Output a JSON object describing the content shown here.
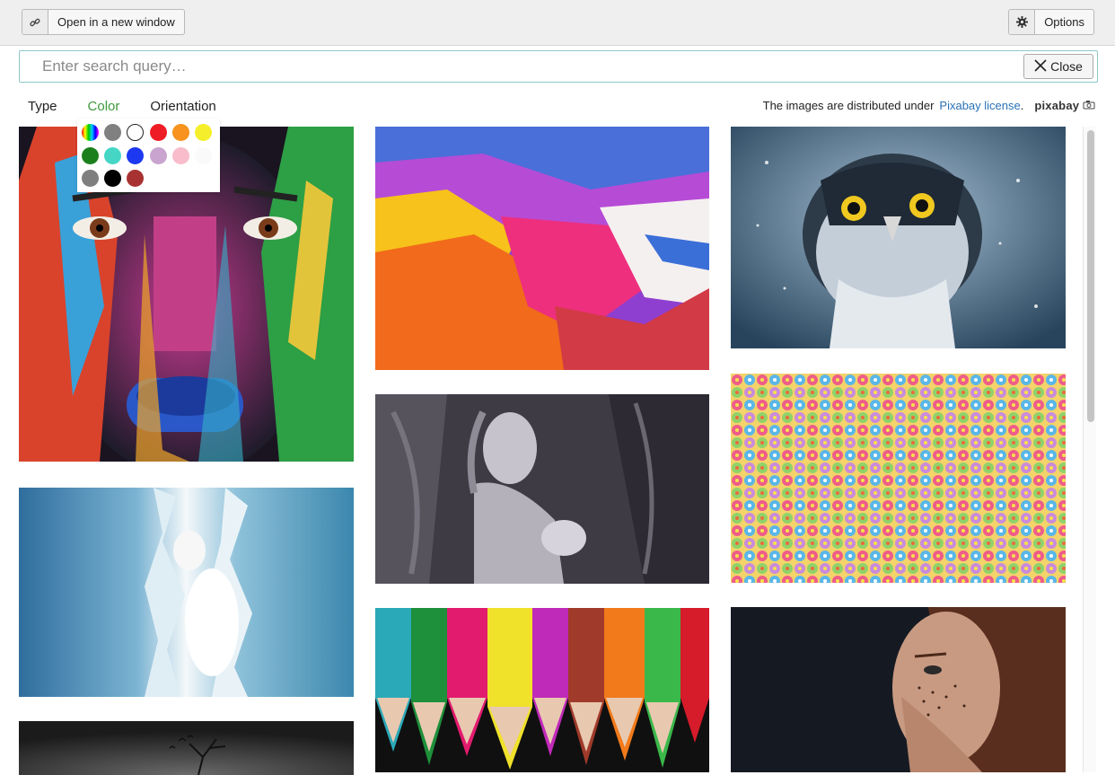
{
  "toolbar": {
    "open_window_label": "Open in a new window",
    "options_label": "Options"
  },
  "search": {
    "placeholder": "Enter search query…",
    "value": "",
    "close_label": "Close"
  },
  "filters": {
    "type_label": "Type",
    "color_label": "Color",
    "orientation_label": "Orientation",
    "active": "Color"
  },
  "license": {
    "prefix": "The images are distributed under",
    "link_text": "Pixabay license",
    "suffix": ".",
    "logo_text": "pixabay"
  },
  "color_filter": {
    "swatches": [
      "gradient",
      "#808080",
      "transparent",
      "#ee1c25",
      "#f7931e",
      "#f5ef2b",
      "#1b7f1b",
      "#45d6c6",
      "#1c38f0",
      "#c9a4cf",
      "#f9bccb",
      "#ffffff",
      "#7f7f7f",
      "#000000",
      "#a83232"
    ]
  },
  "images": [
    {
      "name": "colorful-face-paint"
    },
    {
      "name": "water-splash-woman"
    },
    {
      "name": "dark-tree-silhouette"
    },
    {
      "name": "abstract-paint-texture"
    },
    {
      "name": "stone-woman-fantasy"
    },
    {
      "name": "colored-pencils-bubbles"
    },
    {
      "name": "snowy-owl"
    },
    {
      "name": "flower-pattern"
    },
    {
      "name": "freckled-woman-portrait"
    }
  ]
}
